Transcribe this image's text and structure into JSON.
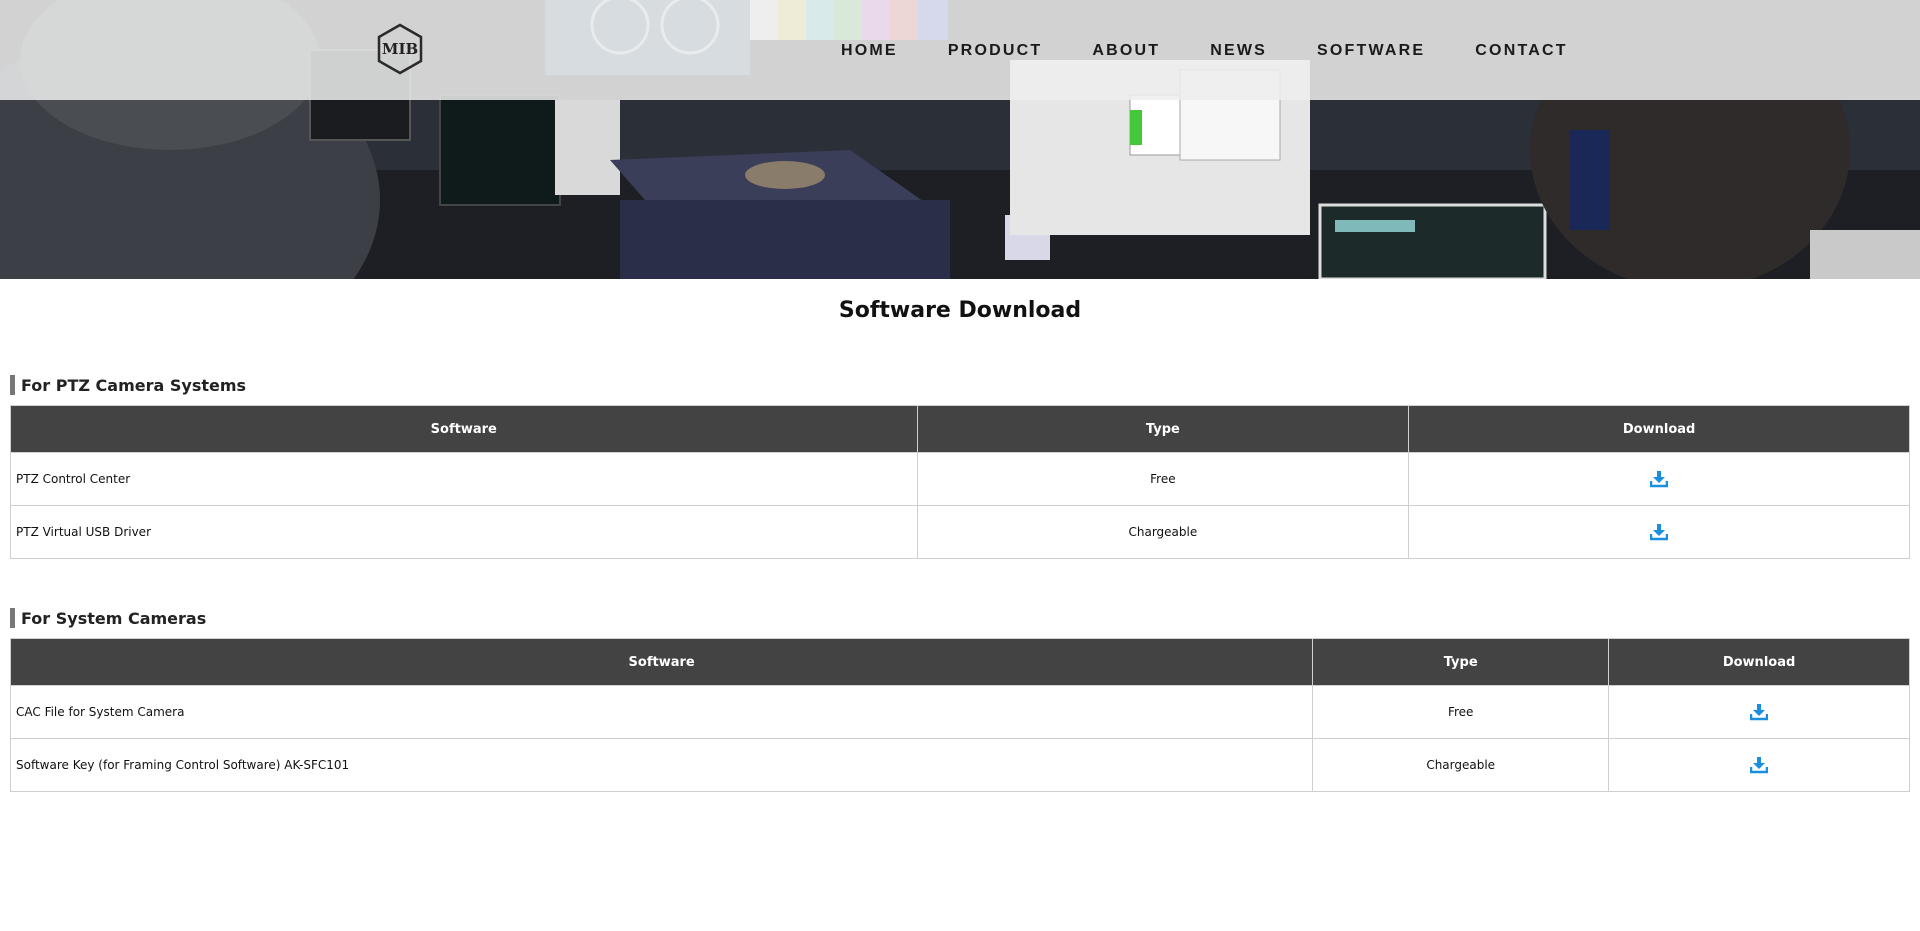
{
  "header": {
    "logo_text": "MIB",
    "nav": [
      "HOME",
      "PRODUCT",
      "ABOUT",
      "NEWS",
      "SOFTWARE",
      "CONTACT"
    ]
  },
  "page_title": "Software Download",
  "sections": [
    {
      "title": "For PTZ Camera Systems",
      "columns": [
        "Software",
        "Type",
        "Download"
      ],
      "rows": [
        {
          "software": "PTZ Control Center",
          "type": "Free",
          "download_icon": "download-icon"
        },
        {
          "software": "PTZ Virtual USB Driver",
          "type": "Chargeable",
          "download_icon": "download-icon"
        }
      ]
    },
    {
      "title": "For System Cameras",
      "columns": [
        "Software",
        "Type",
        "Download"
      ],
      "rows": [
        {
          "software": "CAC File for System Camera",
          "type": "Free",
          "download_icon": "download-icon"
        },
        {
          "software": "Software Key (for Framing Control Software) AK-SFC101",
          "type": "Chargeable",
          "download_icon": "download-icon"
        }
      ]
    }
  ],
  "colors": {
    "table_header_bg": "#434343",
    "download_icon": "#1a8fe0",
    "section_marker": "#777777"
  }
}
